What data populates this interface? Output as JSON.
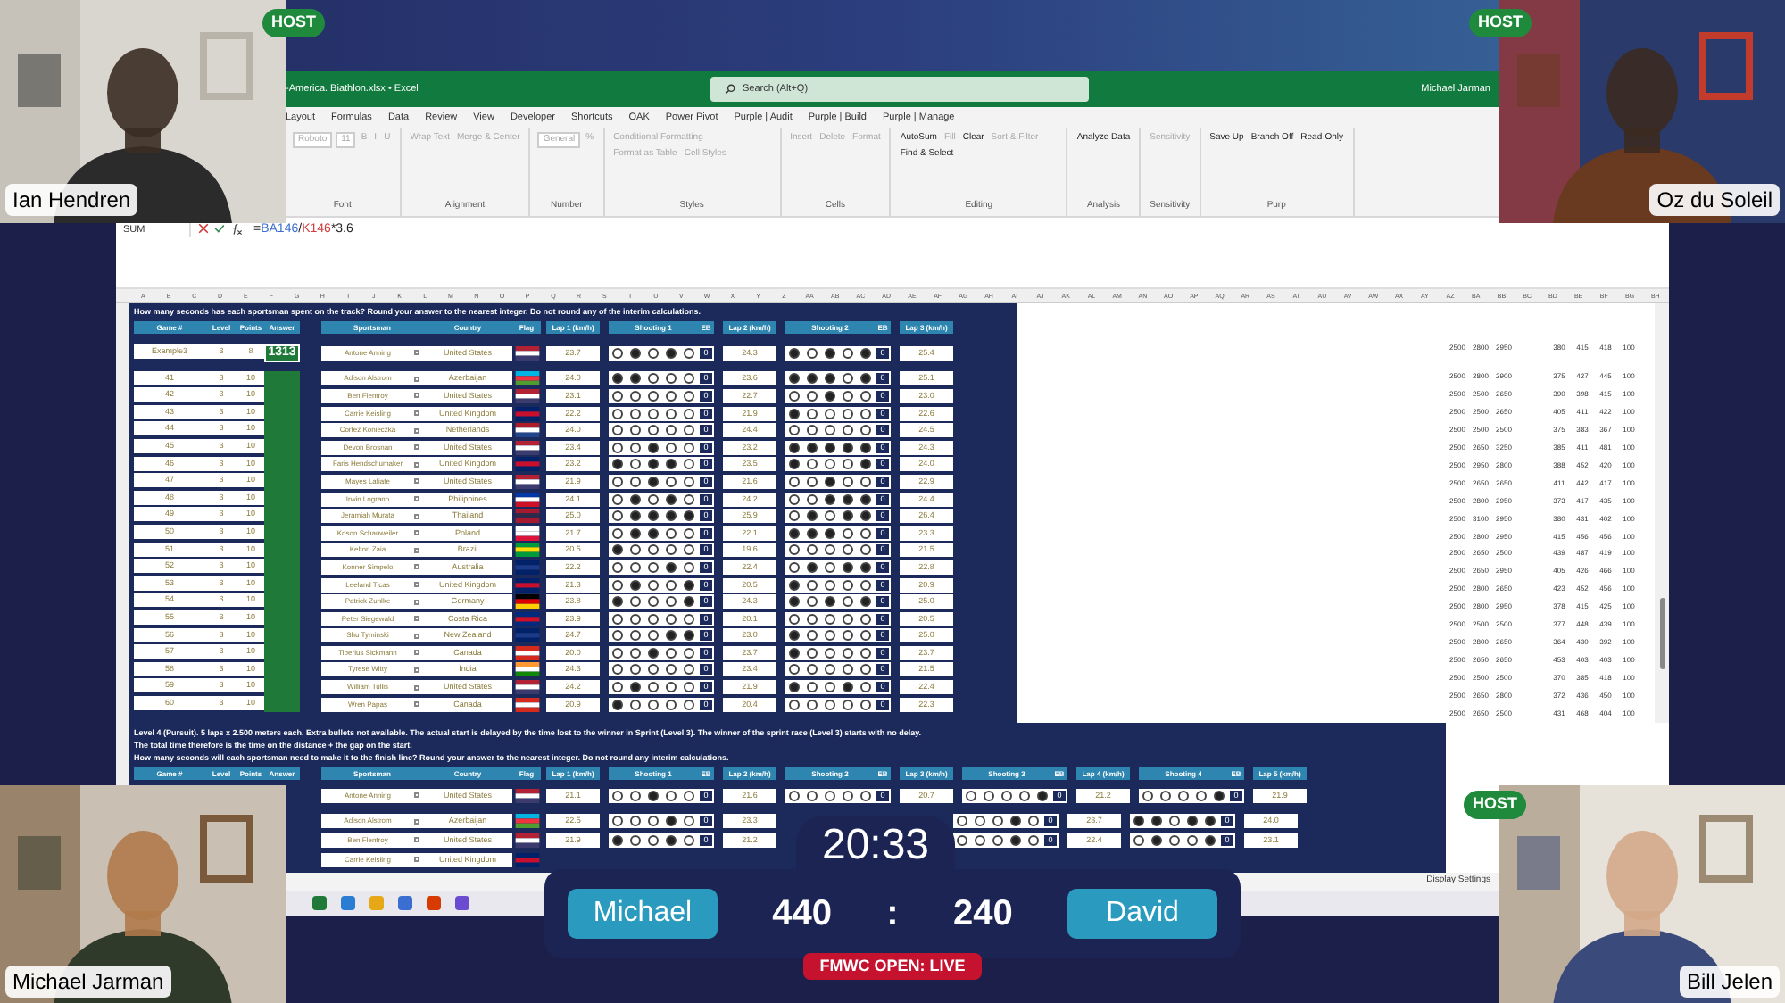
{
  "cameras": [
    {
      "name": "Ian Hendren"
    },
    {
      "name": "Oz du Soleil"
    },
    {
      "name": "Michael Jarman"
    },
    {
      "name": "Bill Jelen"
    }
  ],
  "host_badges": [
    "HOST",
    "HOST",
    "HOST"
  ],
  "excel": {
    "title": "-America. Biathlon.xlsx  •  Excel",
    "search": {
      "placeholder": "Search (Alt+Q)"
    },
    "user": "Michael Jarman",
    "ribbon_tabs": [
      "Layout",
      "Formulas",
      "Data",
      "Review",
      "View",
      "Developer",
      "Shortcuts",
      "OAK",
      "Power Pivot",
      "Purple | Audit",
      "Purple | Build",
      "Purple | Manage"
    ],
    "ribbon_groups": [
      {
        "label": "Font",
        "commands": [
          {
            "kind": "field",
            "text": "Roboto",
            "disabled": true
          },
          {
            "kind": "field",
            "text": "11",
            "disabled": true
          },
          {
            "kind": "button",
            "text": "B",
            "disabled": true
          },
          {
            "kind": "button",
            "text": "I",
            "disabled": true
          },
          {
            "kind": "button",
            "text": "U",
            "disabled": true
          }
        ]
      },
      {
        "label": "Alignment",
        "commands": [
          {
            "kind": "button",
            "text": "Wrap Text",
            "disabled": true
          },
          {
            "kind": "button",
            "text": "Merge & Center",
            "disabled": true
          }
        ]
      },
      {
        "label": "Number",
        "commands": [
          {
            "kind": "field",
            "text": "General",
            "disabled": true
          },
          {
            "kind": "button",
            "text": "%",
            "disabled": true
          }
        ]
      },
      {
        "label": "Styles",
        "commands": [
          {
            "kind": "button",
            "text": "Conditional Formatting",
            "disabled": true
          },
          {
            "kind": "button",
            "text": "Format as Table",
            "disabled": true
          },
          {
            "kind": "button",
            "text": "Cell Styles",
            "disabled": true
          }
        ]
      },
      {
        "label": "Cells",
        "commands": [
          {
            "kind": "button",
            "text": "Insert",
            "disabled": true
          },
          {
            "kind": "button",
            "text": "Delete",
            "disabled": true
          },
          {
            "kind": "button",
            "text": "Format",
            "disabled": true
          }
        ]
      },
      {
        "label": "Editing",
        "commands": [
          {
            "kind": "button",
            "text": "AutoSum",
            "disabled": false
          },
          {
            "kind": "button",
            "text": "Fill",
            "disabled": true
          },
          {
            "kind": "button",
            "text": "Clear",
            "disabled": false
          },
          {
            "kind": "button",
            "text": "Sort & Filter",
            "disabled": true
          },
          {
            "kind": "button",
            "text": "Find & Select",
            "disabled": false
          }
        ]
      },
      {
        "label": "Analysis",
        "commands": [
          {
            "kind": "button",
            "text": "Analyze Data",
            "disabled": false
          }
        ]
      },
      {
        "label": "Sensitivity",
        "commands": [
          {
            "kind": "button",
            "text": "Sensitivity",
            "disabled": true
          }
        ]
      },
      {
        "label": "Purp",
        "commands": [
          {
            "kind": "button",
            "text": "Save Up",
            "disabled": false
          },
          {
            "kind": "button",
            "text": "Branch Off",
            "disabled": false
          },
          {
            "kind": "button",
            "text": "Read-Only",
            "disabled": false
          }
        ]
      }
    ],
    "name_box": "SUM",
    "formula": [
      {
        "text": "=",
        "kind": "plain"
      },
      {
        "text": "BA146",
        "kind": "ref",
        "color": "#3b6fd1"
      },
      {
        "text": "/",
        "kind": "plain"
      },
      {
        "text": "K146",
        "kind": "ref",
        "color": "#d13b3b"
      },
      {
        "text": "*3.6",
        "kind": "plain"
      }
    ],
    "columns": [
      "A",
      "B",
      "C",
      "D",
      "E",
      "F",
      "G",
      "H",
      "I",
      "J",
      "K",
      "L",
      "M",
      "N",
      "O",
      "P",
      "Q",
      "R",
      "S",
      "T",
      "U",
      "V",
      "W",
      "X",
      "Y",
      "Z",
      "AA",
      "AB",
      "AC",
      "AD",
      "AE",
      "AF",
      "AG",
      "AH",
      "AI",
      "AJ",
      "AK",
      "AL",
      "AM",
      "AN",
      "AO",
      "AP",
      "AQ",
      "AR",
      "AS",
      "AT",
      "AU",
      "AV",
      "AW",
      "AX",
      "AY",
      "AZ",
      "BA",
      "BB",
      "BC",
      "BD",
      "BE",
      "BF",
      "BG",
      "BH"
    ],
    "status": "Display Settings"
  },
  "sprint": {
    "question": "How many seconds has each sportsman spent on the track? Round your answer to the nearest integer. Do not round any of the interim calculations.",
    "headers": [
      "Game #",
      "Level",
      "Points",
      "Answer",
      "Sportsman",
      "Country",
      "Flag",
      "Lap 1 (km/h)",
      "Shooting 1",
      "EB",
      "Lap 2 (km/h)",
      "Shooting 2",
      "EB",
      "Lap 3 (km/h)"
    ],
    "example": {
      "game": "Example3",
      "level": "3",
      "points": "8",
      "answer": "1313",
      "sportsman": "Antone Anning",
      "country": "United States",
      "flag": [
        {
          "color": "#b22234"
        },
        {
          "color": "#ffffff"
        },
        {
          "color": "#3c3b6e"
        }
      ],
      "laps": [
        "23.7",
        "24.3",
        "25.4"
      ],
      "shootings": [
        {
          "shots": [
            false,
            true,
            false,
            true,
            false
          ],
          "eb": "0"
        },
        {
          "shots": [
            true,
            false,
            true,
            false,
            true
          ],
          "eb": "0"
        }
      ]
    },
    "rows": [
      {
        "game": "41",
        "level": "3",
        "points": "10",
        "sportsman": "Adison Alstrom",
        "country": "Azerbaijan",
        "flag": [
          {
            "color": "#00b5e2"
          },
          {
            "color": "#ef3340"
          },
          {
            "color": "#509e2f"
          }
        ],
        "laps": [
          "24.0",
          "23.6",
          "25.1"
        ],
        "shootings": [
          {
            "shots": [
              true,
              true,
              false,
              false,
              false
            ],
            "eb": "0"
          },
          {
            "shots": [
              true,
              true,
              true,
              false,
              true
            ],
            "eb": "0"
          }
        ]
      },
      {
        "game": "42",
        "level": "3",
        "points": "10",
        "sportsman": "Ben Flentroy",
        "country": "United States",
        "flag": [
          {
            "color": "#b22234"
          },
          {
            "color": "#ffffff"
          },
          {
            "color": "#3c3b6e"
          }
        ],
        "laps": [
          "23.1",
          "22.7",
          "23.0"
        ],
        "shootings": [
          {
            "shots": [
              false,
              false,
              false,
              false,
              false
            ],
            "eb": "0"
          },
          {
            "shots": [
              false,
              false,
              true,
              false,
              false
            ],
            "eb": "0"
          }
        ]
      },
      {
        "game": "43",
        "level": "3",
        "points": "10",
        "sportsman": "Carrie Keisling",
        "country": "United Kingdom",
        "flag": [
          {
            "color": "#012169"
          },
          {
            "color": "#c8102e"
          },
          {
            "color": "#012169"
          }
        ],
        "laps": [
          "22.2",
          "21.9",
          "22.6"
        ],
        "shootings": [
          {
            "shots": [
              false,
              false,
              false,
              false,
              false
            ],
            "eb": "0"
          },
          {
            "shots": [
              true,
              false,
              false,
              false,
              false
            ],
            "eb": "0"
          }
        ]
      },
      {
        "game": "44",
        "level": "3",
        "points": "10",
        "sportsman": "Cortez Konieczka",
        "country": "Netherlands",
        "flag": [
          {
            "color": "#ae1c28"
          },
          {
            "color": "#ffffff"
          },
          {
            "color": "#21468b"
          }
        ],
        "laps": [
          "24.0",
          "24.4",
          "24.5"
        ],
        "shootings": [
          {
            "shots": [
              false,
              false,
              false,
              false,
              false
            ],
            "eb": "0"
          },
          {
            "shots": [
              false,
              false,
              false,
              false,
              false
            ],
            "eb": "0"
          }
        ]
      },
      {
        "game": "45",
        "level": "3",
        "points": "10",
        "sportsman": "Devon Brosnan",
        "country": "United States",
        "flag": [
          {
            "color": "#b22234"
          },
          {
            "color": "#ffffff"
          },
          {
            "color": "#3c3b6e"
          }
        ],
        "laps": [
          "23.4",
          "23.2",
          "24.3"
        ],
        "shootings": [
          {
            "shots": [
              false,
              false,
              true,
              false,
              false
            ],
            "eb": "0"
          },
          {
            "shots": [
              true,
              true,
              true,
              true,
              true
            ],
            "eb": "0"
          }
        ]
      },
      {
        "game": "46",
        "level": "3",
        "points": "10",
        "sportsman": "Faris Hendschumaker",
        "country": "United Kingdom",
        "flag": [
          {
            "color": "#012169"
          },
          {
            "color": "#c8102e"
          },
          {
            "color": "#012169"
          }
        ],
        "laps": [
          "23.2",
          "23.5",
          "24.0"
        ],
        "shootings": [
          {
            "shots": [
              true,
              false,
              true,
              true,
              false
            ],
            "eb": "0"
          },
          {
            "shots": [
              true,
              false,
              false,
              false,
              true
            ],
            "eb": "0"
          }
        ]
      },
      {
        "game": "47",
        "level": "3",
        "points": "10",
        "sportsman": "Mayes Lafiate",
        "country": "United States",
        "flag": [
          {
            "color": "#b22234"
          },
          {
            "color": "#ffffff"
          },
          {
            "color": "#3c3b6e"
          }
        ],
        "laps": [
          "21.9",
          "21.6",
          "22.9"
        ],
        "shootings": [
          {
            "shots": [
              false,
              false,
              true,
              false,
              false
            ],
            "eb": "0"
          },
          {
            "shots": [
              false,
              false,
              true,
              false,
              false
            ],
            "eb": "0"
          }
        ]
      },
      {
        "game": "48",
        "level": "3",
        "points": "10",
        "sportsman": "Irwin Lograno",
        "country": "Philippines",
        "flag": [
          {
            "color": "#0038a8"
          },
          {
            "color": "#ffffff"
          },
          {
            "color": "#ce1126"
          }
        ],
        "laps": [
          "24.1",
          "24.2",
          "24.4"
        ],
        "shootings": [
          {
            "shots": [
              false,
              true,
              false,
              true,
              false
            ],
            "eb": "0"
          },
          {
            "shots": [
              false,
              false,
              true,
              true,
              true
            ],
            "eb": "0"
          }
        ]
      },
      {
        "game": "49",
        "level": "3",
        "points": "10",
        "sportsman": "Jeramiah Murata",
        "country": "Thailand",
        "flag": [
          {
            "color": "#a51931"
          },
          {
            "color": "#2d2a4a"
          },
          {
            "color": "#a51931"
          }
        ],
        "laps": [
          "25.0",
          "25.9",
          "26.4"
        ],
        "shootings": [
          {
            "shots": [
              false,
              true,
              true,
              true,
              true
            ],
            "eb": "0"
          },
          {
            "shots": [
              false,
              true,
              false,
              true,
              true
            ],
            "eb": "0"
          }
        ]
      },
      {
        "game": "50",
        "level": "3",
        "points": "10",
        "sportsman": "Koson Schauweiler",
        "country": "Poland",
        "flag": [
          {
            "color": "#ffffff"
          },
          {
            "color": "#ffffff"
          },
          {
            "color": "#dc143c"
          }
        ],
        "laps": [
          "21.7",
          "22.1",
          "23.3"
        ],
        "shootings": [
          {
            "shots": [
              false,
              true,
              true,
              false,
              false
            ],
            "eb": "0"
          },
          {
            "shots": [
              true,
              true,
              true,
              false,
              false
            ],
            "eb": "0"
          }
        ]
      },
      {
        "game": "51",
        "level": "3",
        "points": "10",
        "sportsman": "Kelton Zaia",
        "country": "Brazil",
        "flag": [
          {
            "color": "#009c3b"
          },
          {
            "color": "#ffdf00"
          },
          {
            "color": "#009c3b"
          }
        ],
        "laps": [
          "20.5",
          "19.6",
          "21.5"
        ],
        "shootings": [
          {
            "shots": [
              true,
              false,
              false,
              false,
              false
            ],
            "eb": "0"
          },
          {
            "shots": [
              false,
              false,
              false,
              false,
              false
            ],
            "eb": "0"
          }
        ]
      },
      {
        "game": "52",
        "level": "3",
        "points": "10",
        "sportsman": "Konner Simpelo",
        "country": "Australia",
        "flag": [
          {
            "color": "#012169"
          },
          {
            "color": "#1a3a8a"
          },
          {
            "color": "#012169"
          }
        ],
        "laps": [
          "22.2",
          "22.4",
          "22.8"
        ],
        "shootings": [
          {
            "shots": [
              false,
              false,
              false,
              true,
              false
            ],
            "eb": "0"
          },
          {
            "shots": [
              false,
              true,
              false,
              true,
              true
            ],
            "eb": "0"
          }
        ]
      },
      {
        "game": "53",
        "level": "3",
        "points": "10",
        "sportsman": "Leeland Ticas",
        "country": "United Kingdom",
        "flag": [
          {
            "color": "#012169"
          },
          {
            "color": "#c8102e"
          },
          {
            "color": "#012169"
          }
        ],
        "laps": [
          "21.3",
          "20.5",
          "20.9"
        ],
        "shootings": [
          {
            "shots": [
              false,
              true,
              false,
              false,
              true
            ],
            "eb": "0"
          },
          {
            "shots": [
              true,
              false,
              false,
              false,
              false
            ],
            "eb": "0"
          }
        ]
      },
      {
        "game": "54",
        "level": "3",
        "points": "10",
        "sportsman": "Patrick Zuhlke",
        "country": "Germany",
        "flag": [
          {
            "color": "#000000"
          },
          {
            "color": "#dd0000"
          },
          {
            "color": "#ffce00"
          }
        ],
        "laps": [
          "23.8",
          "24.3",
          "25.0"
        ],
        "shootings": [
          {
            "shots": [
              true,
              false,
              false,
              false,
              true
            ],
            "eb": "0"
          },
          {
            "shots": [
              true,
              false,
              true,
              false,
              true
            ],
            "eb": "0"
          }
        ]
      },
      {
        "game": "55",
        "level": "3",
        "points": "10",
        "sportsman": "Peter Siegewald",
        "country": "Costa Rica",
        "flag": [
          {
            "color": "#002b7f"
          },
          {
            "color": "#ce1126"
          },
          {
            "color": "#002b7f"
          }
        ],
        "laps": [
          "23.9",
          "20.1",
          "20.5"
        ],
        "shootings": [
          {
            "shots": [
              false,
              false,
              false,
              false,
              false
            ],
            "eb": "0"
          },
          {
            "shots": [
              false,
              false,
              false,
              false,
              false
            ],
            "eb": "0"
          }
        ]
      },
      {
        "game": "56",
        "level": "3",
        "points": "10",
        "sportsman": "Shu Tyminski",
        "country": "New Zealand",
        "flag": [
          {
            "color": "#012169"
          },
          {
            "color": "#1a3a8a"
          },
          {
            "color": "#012169"
          }
        ],
        "laps": [
          "24.7",
          "23.0",
          "25.0"
        ],
        "shootings": [
          {
            "shots": [
              false,
              false,
              false,
              true,
              true
            ],
            "eb": "0"
          },
          {
            "shots": [
              true,
              false,
              false,
              false,
              false
            ],
            "eb": "0"
          }
        ]
      },
      {
        "game": "57",
        "level": "3",
        "points": "10",
        "sportsman": "Tiberius Sickmann",
        "country": "Canada",
        "flag": [
          {
            "color": "#d52b1e"
          },
          {
            "color": "#ffffff"
          },
          {
            "color": "#d52b1e"
          }
        ],
        "laps": [
          "20.0",
          "23.7",
          "23.7"
        ],
        "shootings": [
          {
            "shots": [
              false,
              false,
              true,
              false,
              false
            ],
            "eb": "0"
          },
          {
            "shots": [
              true,
              false,
              false,
              false,
              false
            ],
            "eb": "0"
          }
        ]
      },
      {
        "game": "58",
        "level": "3",
        "points": "10",
        "sportsman": "Tyrese Witty",
        "country": "India",
        "flag": [
          {
            "color": "#ff9933"
          },
          {
            "color": "#ffffff"
          },
          {
            "color": "#138808"
          }
        ],
        "laps": [
          "24.3",
          "23.4",
          "21.5"
        ],
        "shootings": [
          {
            "shots": [
              false,
              false,
              false,
              false,
              false
            ],
            "eb": "0"
          },
          {
            "shots": [
              false,
              false,
              false,
              false,
              false
            ],
            "eb": "0"
          }
        ]
      },
      {
        "game": "59",
        "level": "3",
        "points": "10",
        "sportsman": "William Tullis",
        "country": "United States",
        "flag": [
          {
            "color": "#b22234"
          },
          {
            "color": "#ffffff"
          },
          {
            "color": "#3c3b6e"
          }
        ],
        "laps": [
          "24.2",
          "21.9",
          "22.4"
        ],
        "shootings": [
          {
            "shots": [
              false,
              true,
              false,
              false,
              false
            ],
            "eb": "0"
          },
          {
            "shots": [
              true,
              false,
              false,
              true,
              false
            ],
            "eb": "0"
          }
        ]
      },
      {
        "game": "60",
        "level": "3",
        "points": "10",
        "sportsman": "Wren Papas",
        "country": "Canada",
        "flag": [
          {
            "color": "#d52b1e"
          },
          {
            "color": "#ffffff"
          },
          {
            "color": "#d52b1e"
          }
        ],
        "laps": [
          "20.9",
          "20.4",
          "22.3"
        ],
        "shootings": [
          {
            "shots": [
              true,
              false,
              false,
              false,
              false
            ],
            "eb": "0"
          },
          {
            "shots": [
              false,
              false,
              false,
              false,
              false
            ],
            "eb": "0"
          }
        ]
      }
    ]
  },
  "distances": [
    {
      "values": [
        "2500",
        "2800",
        "2950",
        "380",
        "415",
        "418",
        "100"
      ]
    },
    {
      "values": [
        "2500",
        "2800",
        "2900",
        "375",
        "427",
        "445",
        "100"
      ]
    },
    {
      "values": [
        "2500",
        "2500",
        "2650",
        "390",
        "398",
        "415",
        "100"
      ]
    },
    {
      "values": [
        "2500",
        "2500",
        "2650",
        "405",
        "411",
        "422",
        "100"
      ]
    },
    {
      "values": [
        "2500",
        "2500",
        "2500",
        "375",
        "383",
        "367",
        "100"
      ]
    },
    {
      "values": [
        "2500",
        "2650",
        "3250",
        "385",
        "411",
        "481",
        "100"
      ]
    },
    {
      "values": [
        "2500",
        "2950",
        "2800",
        "388",
        "452",
        "420",
        "100"
      ]
    },
    {
      "values": [
        "2500",
        "2650",
        "2650",
        "411",
        "442",
        "417",
        "100"
      ]
    },
    {
      "values": [
        "2500",
        "2800",
        "2950",
        "373",
        "417",
        "435",
        "100"
      ]
    },
    {
      "values": [
        "2500",
        "3100",
        "2950",
        "380",
        "431",
        "402",
        "100"
      ]
    },
    {
      "values": [
        "2500",
        "2800",
        "2950",
        "415",
        "456",
        "456",
        "100"
      ]
    },
    {
      "values": [
        "2500",
        "2650",
        "2500",
        "439",
        "487",
        "419",
        "100"
      ]
    },
    {
      "values": [
        "2500",
        "2650",
        "2950",
        "405",
        "426",
        "466",
        "100"
      ]
    },
    {
      "values": [
        "2500",
        "2800",
        "2650",
        "423",
        "452",
        "456",
        "100"
      ]
    },
    {
      "values": [
        "2500",
        "2800",
        "2950",
        "378",
        "415",
        "425",
        "100"
      ]
    },
    {
      "values": [
        "2500",
        "2500",
        "2500",
        "377",
        "448",
        "439",
        "100"
      ]
    },
    {
      "values": [
        "2500",
        "2800",
        "2650",
        "364",
        "430",
        "392",
        "100"
      ]
    },
    {
      "values": [
        "2500",
        "2650",
        "2650",
        "453",
        "403",
        "403",
        "100"
      ]
    },
    {
      "values": [
        "2500",
        "2500",
        "2500",
        "370",
        "385",
        "418",
        "100"
      ]
    },
    {
      "values": [
        "2500",
        "2650",
        "2800",
        "372",
        "436",
        "450",
        "100"
      ]
    },
    {
      "values": [
        "2500",
        "2650",
        "2500",
        "431",
        "468",
        "404",
        "100"
      ]
    }
  ],
  "pursuit": {
    "notes": [
      "Level 4 (Pursuit). 5 laps x 2.500 meters each. Extra bullets not available. The actual start is delayed by the time lost to the winner in Sprint (Level 3). The winner of the sprint race (Level 3) starts with no delay.",
      "The total time therefore is the time on the distance + the gap on the start.",
      "How many seconds will each sportsman need to make it to the finish line? Round your answer to the nearest integer. Do not round any interim calculations."
    ],
    "headers": [
      "Game #",
      "Level",
      "Points",
      "Answer",
      "Sportsman",
      "Country",
      "Flag",
      "Lap 1 (km/h)",
      "Shooting 1",
      "EB",
      "Lap 2 (km/h)",
      "Shooting 2",
      "EB",
      "Lap 3 (km/h)",
      "Shooting 3",
      "EB",
      "Lap 4 (km/h)",
      "Shooting 4",
      "EB",
      "Lap 5 (km/h)"
    ],
    "rows": [
      {
        "sportsman": "Antone Anning",
        "country": "United States",
        "flag": [
          {
            "color": "#b22234"
          },
          {
            "color": "#ffffff"
          },
          {
            "color": "#3c3b6e"
          }
        ],
        "segments": [
          {
            "kind": "lap",
            "value": "21.1"
          },
          {
            "kind": "shooting",
            "shots": [
              false,
              false,
              true,
              false,
              false
            ],
            "eb": "0"
          },
          {
            "kind": "lap",
            "value": "21.6"
          },
          {
            "kind": "shooting",
            "shots": [
              false,
              false,
              false,
              false,
              false
            ],
            "eb": "0"
          },
          {
            "kind": "lap",
            "value": "20.7"
          },
          {
            "kind": "shooting",
            "shots": [
              false,
              false,
              false,
              false,
              true
            ],
            "eb": "0"
          },
          {
            "kind": "lap",
            "value": "21.2"
          },
          {
            "kind": "shooting",
            "shots": [
              false,
              false,
              false,
              false,
              true
            ],
            "eb": "0"
          },
          {
            "kind": "lap",
            "value": "21.9"
          }
        ]
      },
      {
        "sportsman": "Adison Alstrom",
        "country": "Azerbaijan",
        "flag": [
          {
            "color": "#00b5e2"
          },
          {
            "color": "#ef3340"
          },
          {
            "color": "#509e2f"
          }
        ],
        "segments": [
          {
            "kind": "lap",
            "value": "22.5"
          },
          {
            "kind": "shooting",
            "shots": [
              false,
              false,
              false,
              true,
              false
            ],
            "eb": "0"
          },
          {
            "kind": "lap",
            "value": "23.3"
          },
          {
            "kind": "covered"
          },
          {
            "kind": "shooting",
            "shots": [
              false,
              false,
              false,
              true,
              false
            ],
            "eb": "0"
          },
          {
            "kind": "lap",
            "value": "23.7"
          },
          {
            "kind": "shooting",
            "shots": [
              true,
              true,
              false,
              true,
              true
            ],
            "eb": "0"
          },
          {
            "kind": "lap",
            "value": "24.0"
          }
        ]
      },
      {
        "sportsman": "Ben Flentroy",
        "country": "United States",
        "flag": [
          {
            "color": "#b22234"
          },
          {
            "color": "#ffffff"
          },
          {
            "color": "#3c3b6e"
          }
        ],
        "segments": [
          {
            "kind": "lap",
            "value": "21.9"
          },
          {
            "kind": "shooting",
            "shots": [
              true,
              false,
              false,
              true,
              false
            ],
            "eb": "0"
          },
          {
            "kind": "lap",
            "value": "21.2"
          },
          {
            "kind": "covered"
          },
          {
            "kind": "shooting",
            "shots": [
              false,
              false,
              false,
              true,
              false
            ],
            "eb": "0"
          },
          {
            "kind": "lap",
            "value": "22.4"
          },
          {
            "kind": "shooting",
            "shots": [
              false,
              true,
              false,
              false,
              true
            ],
            "eb": "0"
          },
          {
            "kind": "lap",
            "value": "23.1"
          }
        ]
      },
      {
        "sportsman": "Carrie Keisling",
        "country": "United Kingdom",
        "flag": [
          {
            "color": "#012169"
          },
          {
            "color": "#c8102e"
          },
          {
            "color": "#012169"
          }
        ]
      }
    ]
  },
  "scoreboard": {
    "timer": "20:33",
    "players": [
      {
        "name": "Michael",
        "score": "440"
      },
      {
        "name": "David",
        "score": "240"
      }
    ],
    "separator": ":",
    "live": "FMWC OPEN: LIVE"
  }
}
